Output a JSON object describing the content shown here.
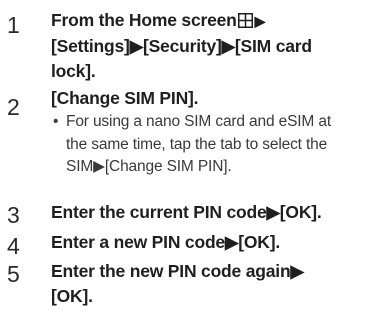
{
  "steps": [
    {
      "number": "1",
      "line1_pre": "From the Home screen",
      "line1_post": "▶",
      "line2": "[Settings]▶[Security]▶[SIM card",
      "line3": "lock].",
      "icon": "home-grid-icon"
    },
    {
      "number": "2",
      "line1": "[Change SIM PIN].",
      "bullet_symbol": "•",
      "bullet_line1": "For using a nano SIM card and eSIM at",
      "bullet_line2": "the same time, tap the tab to select the",
      "bullet_line3": "SIM▶[Change SIM PIN]."
    },
    {
      "number": "3",
      "line1": "Enter the current PIN code▶[OK]."
    },
    {
      "number": "4",
      "line1": "Enter a new PIN code▶[OK]."
    },
    {
      "number": "5",
      "line1": "Enter the new PIN code again▶",
      "line2": "[OK]."
    }
  ]
}
